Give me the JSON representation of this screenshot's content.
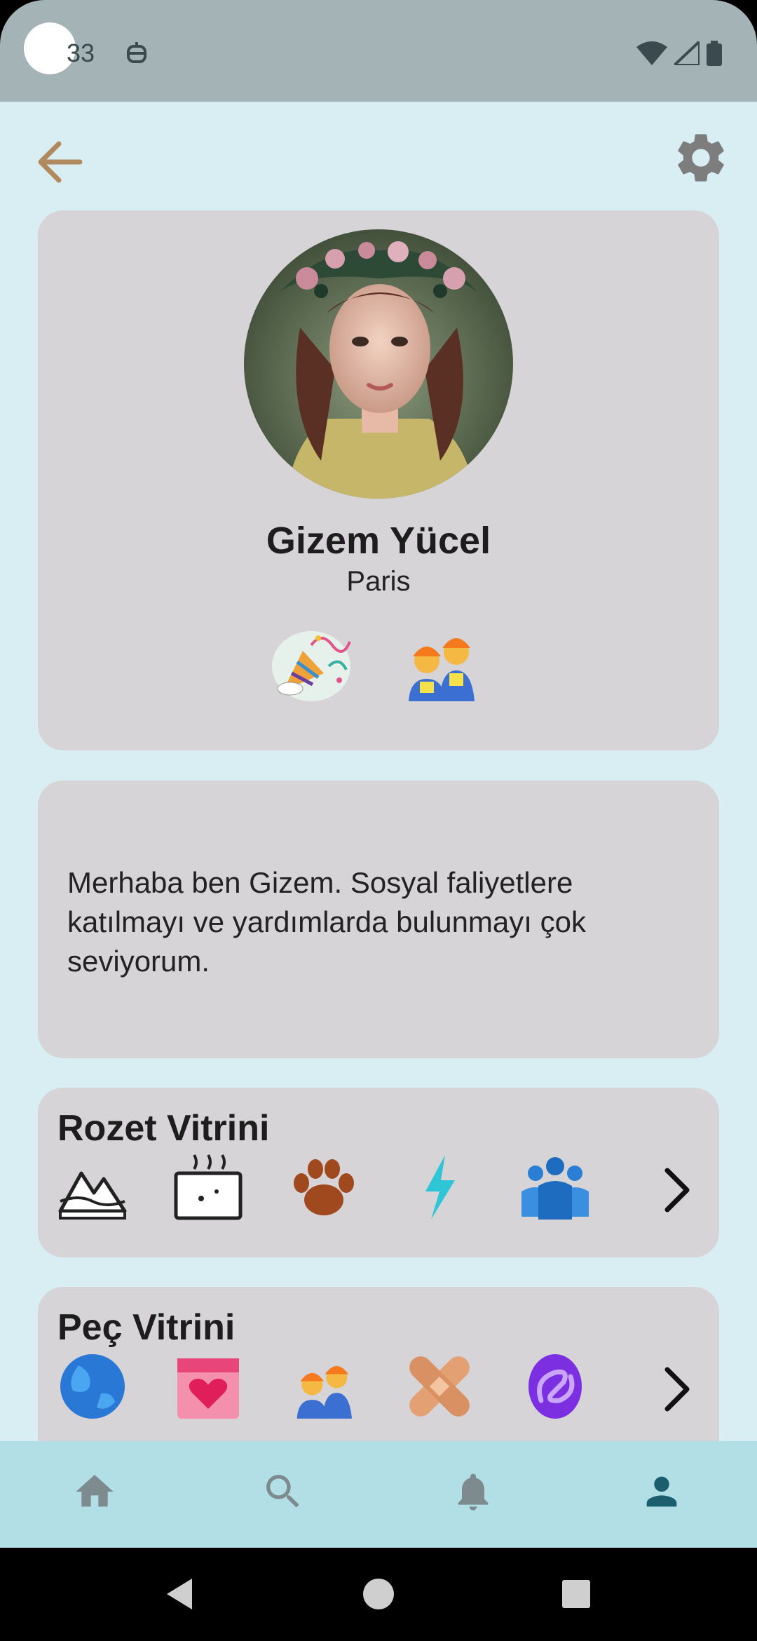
{
  "status_bar": {
    "time": "33",
    "icons": [
      "wifi-icon",
      "signal-icon",
      "battery-icon"
    ]
  },
  "header": {
    "back_icon": "arrow-left-icon",
    "settings_icon": "gear-icon"
  },
  "profile": {
    "name": "Gizem Yücel",
    "city": "Paris",
    "role_icons": [
      "party-popper-icon",
      "construction-workers-icon"
    ]
  },
  "bio": {
    "text": "Merhaba ben Gizem. Sosyal faliyetlere katılmayı ve yardımlarda bulunmayı çok seviyorum."
  },
  "badge_showcase": {
    "title": "Rozet Vitrini",
    "icons": [
      "mountain-icon",
      "calendar-steam-icon",
      "paw-print-icon",
      "lightning-icon",
      "people-group-icon"
    ],
    "more_icon": "chevron-right-icon"
  },
  "patch_showcase": {
    "title": "Peç Vitrini",
    "icons": [
      "globe-icon",
      "heart-calendar-icon",
      "construction-workers-icon",
      "bandage-icon",
      "purple-swirl-icon"
    ],
    "more_icon": "chevron-right-icon"
  },
  "bottom_nav": {
    "items": [
      "home-icon",
      "search-icon",
      "bell-icon",
      "profile-icon"
    ],
    "active": "profile-icon",
    "colors": {
      "inactive": "#7d8a8e",
      "active": "#1c5e6e"
    }
  },
  "colors": {
    "accent_back": "#b08a5e",
    "card": "#d6d4d6",
    "page": "#d8eef2"
  }
}
